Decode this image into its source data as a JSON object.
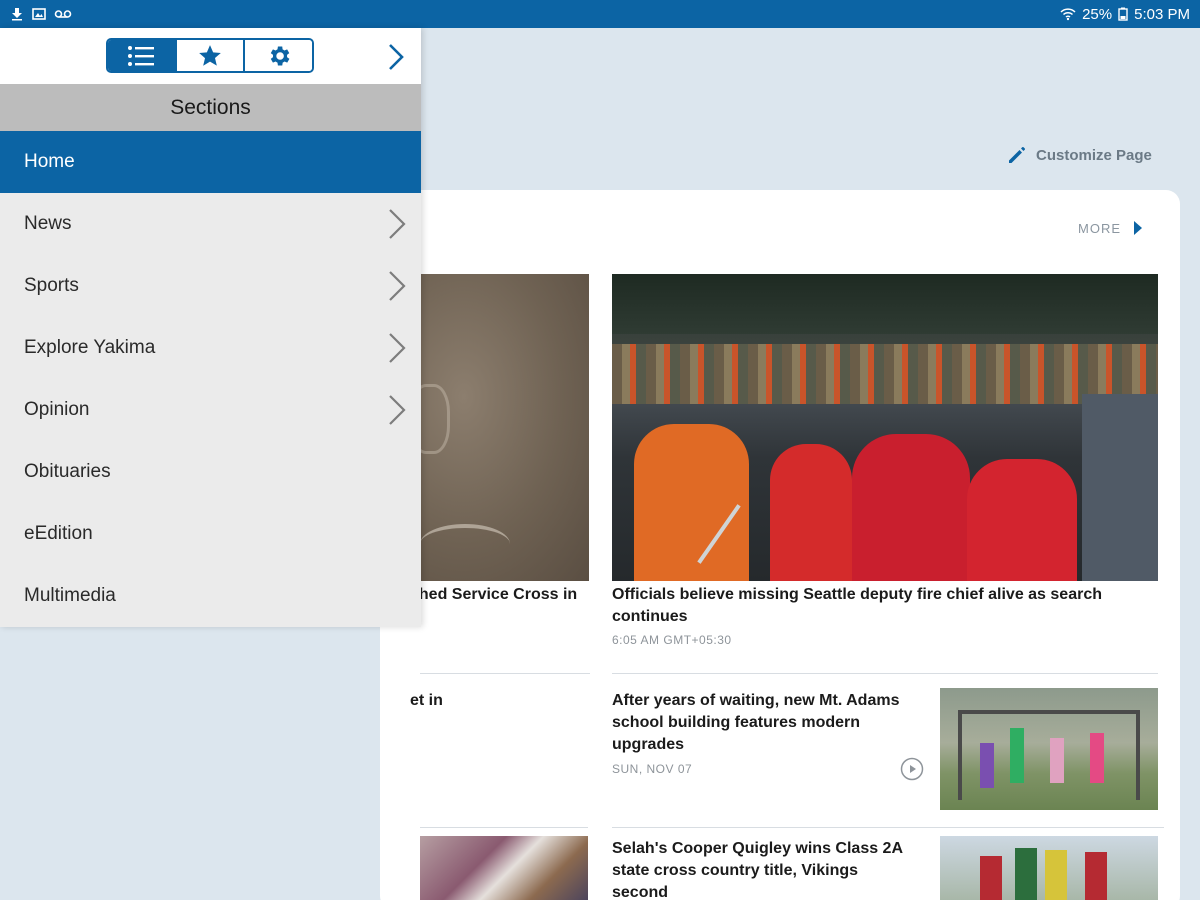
{
  "statusbar": {
    "battery": "25%",
    "time": "5:03 PM"
  },
  "page": {
    "customize_label": "Customize Page",
    "more_label": "MORE",
    "stories": [
      {
        "title": "shed Service Cross in"
      },
      {
        "title": "Officials believe missing Seattle deputy fire chief alive as search continues",
        "time": "6:05 AM GMT+05:30"
      },
      {
        "title": "et in"
      },
      {
        "title": "After years of waiting, new Mt. Adams school building features modern upgrades",
        "time": "SUN, NOV 07"
      },
      {
        "title": "Selah's Cooper Quigley wins Class 2A state cross country title, Vikings second"
      }
    ]
  },
  "drawer": {
    "heading": "Sections",
    "items": [
      {
        "label": "Home",
        "active": true,
        "chevron": false
      },
      {
        "label": "News",
        "active": false,
        "chevron": true
      },
      {
        "label": "Sports",
        "active": false,
        "chevron": true
      },
      {
        "label": "Explore Yakima",
        "active": false,
        "chevron": true
      },
      {
        "label": "Opinion",
        "active": false,
        "chevron": true
      },
      {
        "label": "Obituaries",
        "active": false,
        "chevron": false
      },
      {
        "label": "eEdition",
        "active": false,
        "chevron": false
      },
      {
        "label": "Multimedia",
        "active": false,
        "chevron": false
      }
    ]
  },
  "colors": {
    "primary": "#0c64a4",
    "drawer_bg": "#ebebeb",
    "section_head": "#bcbcbc",
    "page_bg": "#dce6ee"
  },
  "icons": [
    "download-icon",
    "image-icon",
    "voicemail-icon",
    "wifi-icon",
    "battery-icon",
    "list-icon",
    "star-icon",
    "gear-icon",
    "chevron-right-icon",
    "pencil-icon",
    "play-icon"
  ]
}
